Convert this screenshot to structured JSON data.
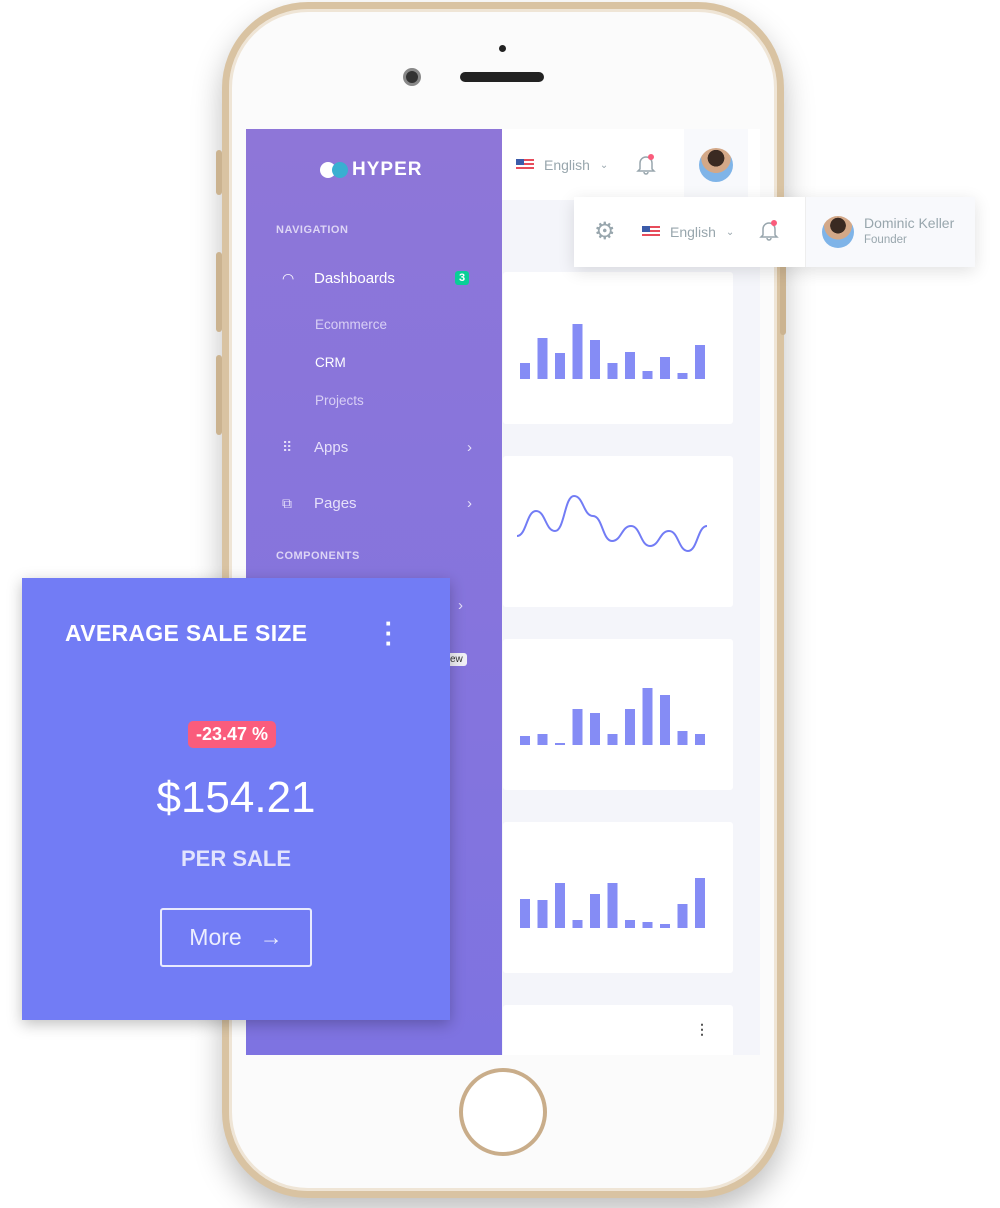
{
  "brand": {
    "name": "HYPER"
  },
  "sidebar": {
    "section_navigation": "NAVIGATION",
    "dashboards": {
      "label": "Dashboards",
      "badge": "3"
    },
    "sub_items": [
      "Ecommerce",
      "CRM",
      "Projects"
    ],
    "apps": "Apps",
    "pages": "Pages",
    "section_components": "COMPONENTS",
    "new_badge": "ew"
  },
  "topbar": {
    "language": "English"
  },
  "overlay_topbar": {
    "language": "English",
    "user_name": "Dominic Keller",
    "user_role": "Founder"
  },
  "widget": {
    "title": "AVERAGE SALE SIZE",
    "change": "-23.47 %",
    "value": "$154.21",
    "caption": "PER SALE",
    "more_label": "More"
  },
  "colors": {
    "primary": "#727cf5",
    "sidebar": "#8a75dc",
    "success": "#0acf97",
    "danger": "#fa5c7c"
  },
  "chart_data": [
    {
      "type": "bar",
      "values": [
        16,
        41,
        26,
        55,
        39,
        16,
        27,
        8,
        22,
        6,
        34
      ]
    },
    {
      "type": "line",
      "values": [
        20,
        45,
        25,
        60,
        40,
        15,
        30,
        10,
        25,
        5,
        30
      ]
    },
    {
      "type": "bar",
      "values": [
        9,
        11,
        2,
        36,
        32,
        11,
        36,
        57,
        50,
        14,
        11
      ]
    },
    {
      "type": "bar",
      "values": [
        29,
        28,
        45,
        8,
        34,
        45,
        8,
        6,
        4,
        24,
        50
      ]
    }
  ]
}
